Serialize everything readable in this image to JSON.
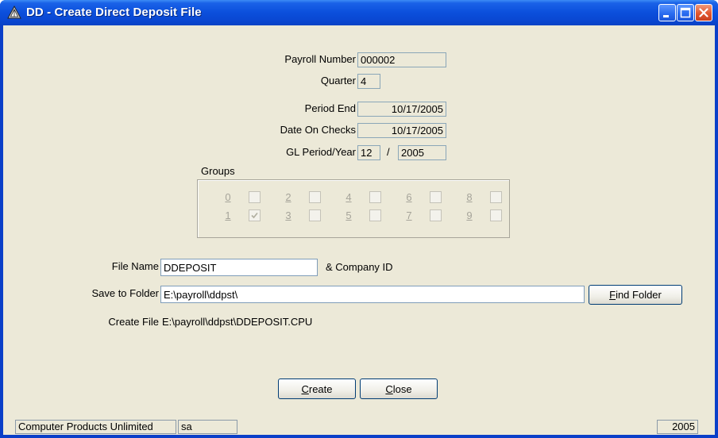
{
  "window": {
    "title": "DD - Create Direct Deposit File"
  },
  "payroll": {
    "payroll_number_label": "Payroll Number",
    "payroll_number": "000002",
    "quarter_label": "Quarter",
    "quarter": "4",
    "period_end_label": "Period End",
    "period_end": "10/17/2005",
    "date_on_checks_label": "Date On Checks",
    "date_on_checks": "10/17/2005",
    "gl_period_label": "GL Period/Year",
    "gl_period": "12",
    "gl_separator": "/",
    "gl_year": "2005"
  },
  "groups": {
    "label": "Groups",
    "items": [
      {
        "num": "0",
        "checked": false
      },
      {
        "num": "1",
        "checked": true
      },
      {
        "num": "2",
        "checked": false
      },
      {
        "num": "3",
        "checked": false
      },
      {
        "num": "4",
        "checked": false
      },
      {
        "num": "5",
        "checked": false
      },
      {
        "num": "6",
        "checked": false
      },
      {
        "num": "7",
        "checked": false
      },
      {
        "num": "8",
        "checked": false
      },
      {
        "num": "9",
        "checked": false
      }
    ]
  },
  "file": {
    "file_name_label": "File Name",
    "file_name": "DDEPOSIT",
    "company_suffix": "& Company ID",
    "save_folder_label": "Save to Folder",
    "save_folder": "E:\\payroll\\ddpst\\",
    "find_folder_accel": "F",
    "find_folder_rest": "ind Folder",
    "create_file_label": "Create File",
    "create_file_path": "E:\\payroll\\ddpst\\DDEPOSIT.CPU"
  },
  "actions": {
    "create_accel": "C",
    "create_rest": "reate",
    "close_accel": "C",
    "close_rest": "lose"
  },
  "statusbar": {
    "company": "Computer Products Unlimited",
    "user": "sa",
    "year": "2005"
  },
  "colors": {
    "titlebar": "#0b4fdc",
    "client_bg": "#ece9d8",
    "close_button": "#e2562d"
  }
}
